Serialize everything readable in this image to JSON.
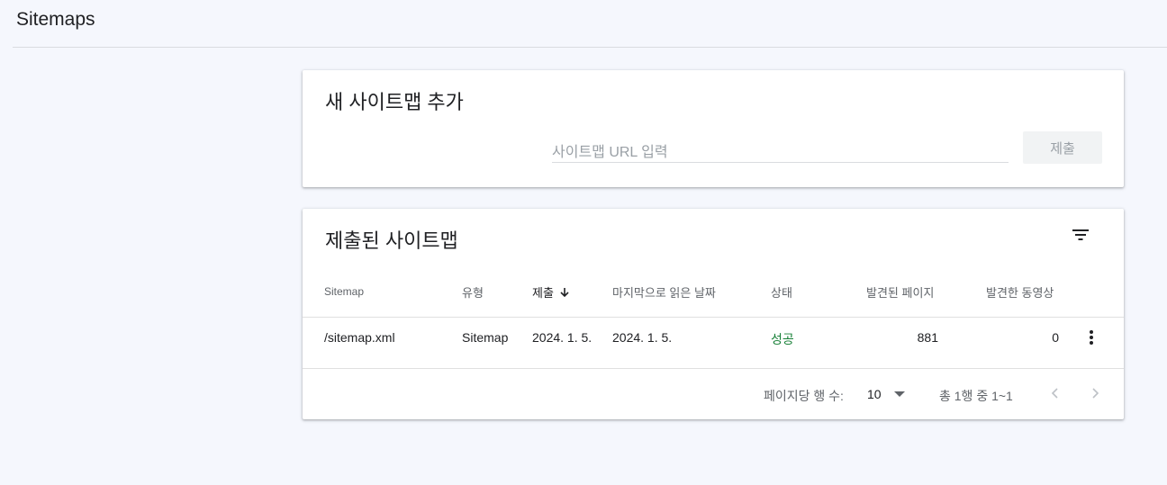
{
  "header": {
    "title": "Sitemaps"
  },
  "add_card": {
    "title": "새 사이트맵 추가",
    "input_placeholder": "사이트맵 URL 입력",
    "input_value": "",
    "submit_label": "제출"
  },
  "list_card": {
    "title": "제출된 사이트맵",
    "filter_icon": "filter-icon",
    "columns": {
      "sitemap": "Sitemap",
      "type": "유형",
      "submitted": "제출",
      "last_read": "마지막으로 읽은 날짜",
      "status": "상태",
      "discovered_pages": "발견된 페이지",
      "discovered_videos": "발견한 동영상"
    },
    "rows": [
      {
        "sitemap": "/sitemap.xml",
        "type": "Sitemap",
        "submitted": "2024. 1. 5.",
        "last_read": "2024. 1. 5.",
        "status": "성공",
        "discovered_pages": "881",
        "discovered_videos": "0"
      }
    ],
    "pagination": {
      "rows_per_page_label": "페이지당 행 수:",
      "rows_per_page_value": "10",
      "range_text": "총 1행 중 1~1"
    }
  },
  "colors": {
    "background": "#f5f7fd",
    "success": "#188038",
    "muted": "#5f6368"
  }
}
